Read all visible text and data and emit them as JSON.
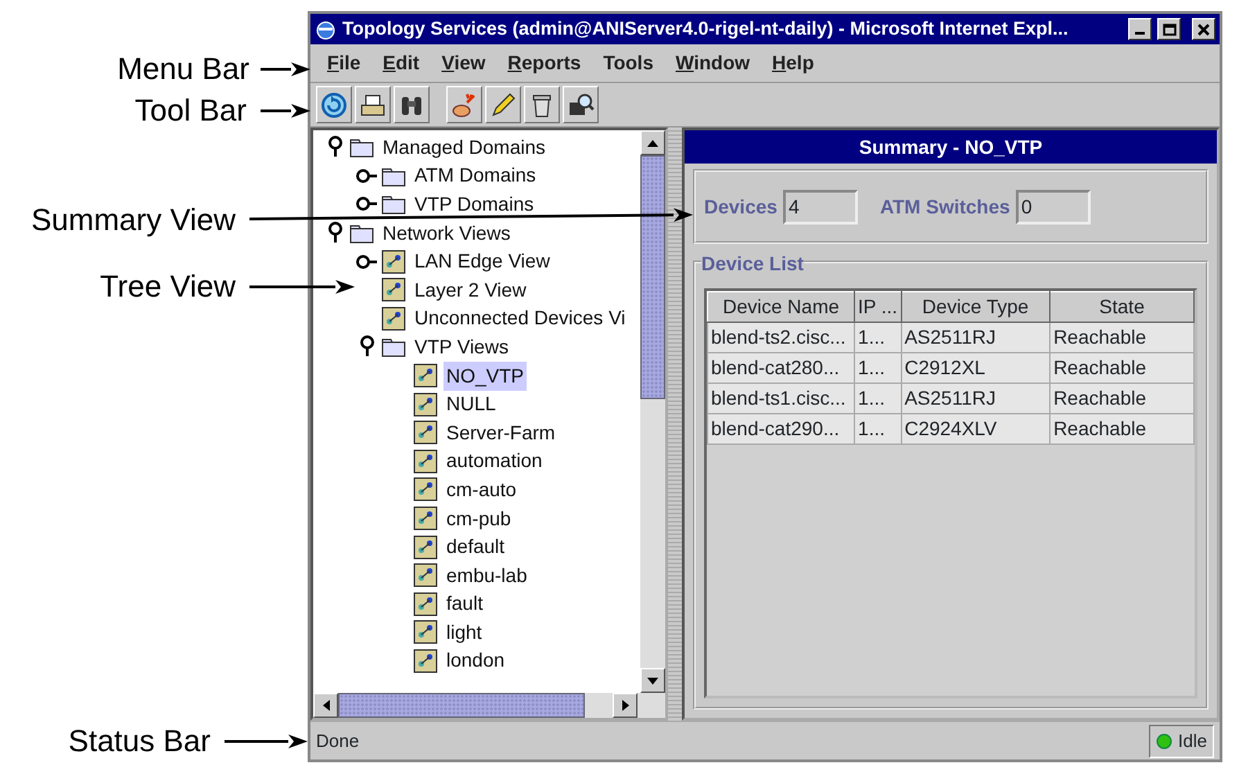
{
  "callouts": [
    {
      "label": "Menu Bar"
    },
    {
      "label": "Tool Bar"
    },
    {
      "label": "Summary View"
    },
    {
      "label": "Tree View"
    },
    {
      "label": "Status Bar"
    }
  ],
  "window": {
    "title": "Topology Services (admin@ANIServer4.0-rigel-nt-daily) - Microsoft Internet Expl..."
  },
  "menu": [
    {
      "label": "File",
      "underlined": true
    },
    {
      "label": "Edit",
      "underlined": true
    },
    {
      "label": "View",
      "underlined": true
    },
    {
      "label": "Reports",
      "underlined": true
    },
    {
      "label": "Tools",
      "underlined": false
    },
    {
      "label": "Window",
      "underlined": true
    },
    {
      "label": "Help",
      "underlined": true
    }
  ],
  "tree": [
    {
      "label": "Managed Domains",
      "kind": "folder",
      "expanded": true,
      "selected": false,
      "children": [
        {
          "label": "ATM Domains",
          "kind": "folder",
          "expanded": false,
          "selected": false
        },
        {
          "label": "VTP Domains",
          "kind": "folder",
          "expanded": false,
          "selected": false
        }
      ]
    },
    {
      "label": "Network Views",
      "kind": "folder",
      "expanded": true,
      "selected": false,
      "children": [
        {
          "label": "LAN Edge View",
          "kind": "view",
          "expanded": false,
          "selected": false
        },
        {
          "label": "Layer 2 View",
          "kind": "view",
          "selected": false
        },
        {
          "label": "Unconnected Devices Vi",
          "kind": "view",
          "selected": false
        },
        {
          "label": "VTP Views",
          "kind": "folder",
          "expanded": true,
          "selected": false,
          "children": [
            {
              "label": "NO_VTP",
              "kind": "view",
              "selected": true
            },
            {
              "label": "NULL",
              "kind": "view",
              "selected": false
            },
            {
              "label": "Server-Farm",
              "kind": "view",
              "selected": false
            },
            {
              "label": "automation",
              "kind": "view",
              "selected": false
            },
            {
              "label": "cm-auto",
              "kind": "view",
              "selected": false
            },
            {
              "label": "cm-pub",
              "kind": "view",
              "selected": false
            },
            {
              "label": "default",
              "kind": "view",
              "selected": false
            },
            {
              "label": "embu-lab",
              "kind": "view",
              "selected": false
            },
            {
              "label": "fault",
              "kind": "view",
              "selected": false
            },
            {
              "label": "light",
              "kind": "view",
              "selected": false
            },
            {
              "label": "london",
              "kind": "view",
              "selected": false
            }
          ]
        }
      ]
    }
  ],
  "summary": {
    "title": "Summary - NO_VTP",
    "fields": [
      {
        "label": "Devices",
        "value": "4"
      },
      {
        "label": "ATM Switches",
        "value": "0"
      }
    ],
    "device_list": {
      "title": "Device List",
      "columns": [
        "Device Name",
        "IP ...",
        "Device Type",
        "State"
      ],
      "rows": [
        [
          "blend-ts2.cisc...",
          "1...",
          "AS2511RJ",
          "Reachable"
        ],
        [
          "blend-cat280...",
          "1...",
          "C2912XL",
          "Reachable"
        ],
        [
          "blend-ts1.cisc...",
          "1...",
          "AS2511RJ",
          "Reachable"
        ],
        [
          "blend-cat290...",
          "1...",
          "C2924XLV",
          "Reachable"
        ]
      ]
    }
  },
  "status_bar": {
    "message": "Done",
    "state": "Idle"
  }
}
